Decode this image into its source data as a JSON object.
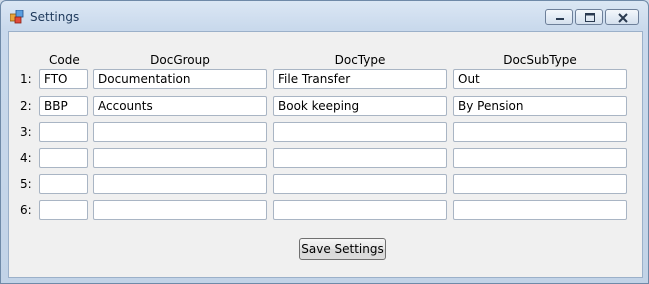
{
  "window": {
    "title": "Settings",
    "controls": {
      "minimize": "minimize-icon",
      "maximize": "maximize-icon",
      "close": "close-icon"
    }
  },
  "columns": [
    "Code",
    "DocGroup",
    "DocType",
    "DocSubType"
  ],
  "rows": [
    {
      "label": "1:",
      "code": "FTO",
      "group": "Documentation",
      "type": "File Transfer",
      "subtype": "Out"
    },
    {
      "label": "2:",
      "code": "BBP",
      "group": "Accounts",
      "type": "Book keeping",
      "subtype": "By Pension"
    },
    {
      "label": "3:",
      "code": "",
      "group": "",
      "type": "",
      "subtype": ""
    },
    {
      "label": "4:",
      "code": "",
      "group": "",
      "type": "",
      "subtype": ""
    },
    {
      "label": "5:",
      "code": "",
      "group": "",
      "type": "",
      "subtype": ""
    },
    {
      "label": "6:",
      "code": "",
      "group": "",
      "type": "",
      "subtype": ""
    }
  ],
  "save_button": "Save Settings"
}
